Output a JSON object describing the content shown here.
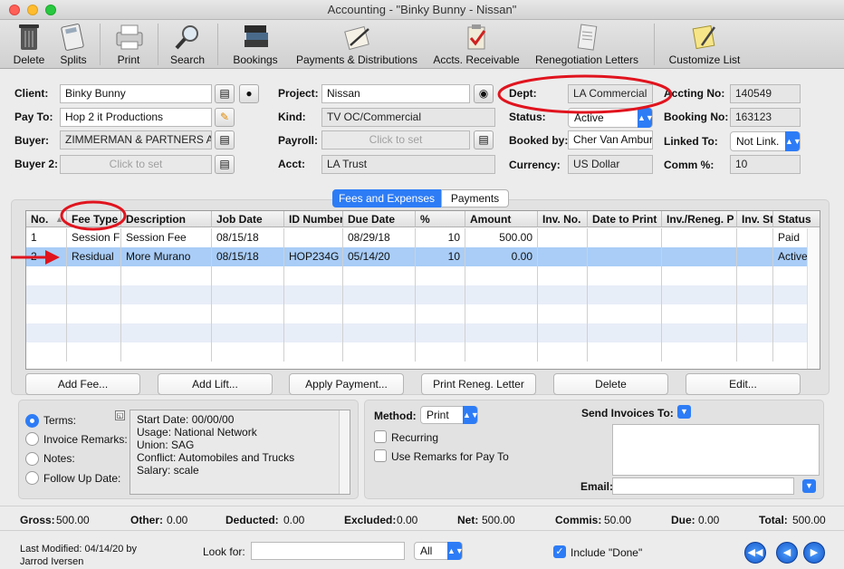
{
  "window": {
    "title": "Accounting - \"Binky Bunny - Nissan\""
  },
  "toolbar": {
    "delete": "Delete",
    "splits": "Splits",
    "print": "Print",
    "search": "Search",
    "bookings": "Bookings",
    "payments": "Payments & Distributions",
    "receivable": "Accts. Receivable",
    "renegotiation": "Renegotiation Letters",
    "customize": "Customize List"
  },
  "form": {
    "client_label": "Client:",
    "client": "Binky Bunny",
    "payto_label": "Pay To:",
    "payto": "Hop 2 it Productions",
    "buyer_label": "Buyer:",
    "buyer": "ZIMMERMAN & PARTNERS ADV",
    "buyer2_label": "Buyer 2:",
    "buyer2_placeholder": "Click to set",
    "project_label": "Project:",
    "project": "Nissan",
    "kind_label": "Kind:",
    "kind": "TV OC/Commercial",
    "payroll_label": "Payroll:",
    "payroll_placeholder": "Click to set",
    "acct_label": "Acct:",
    "acct": "LA Trust",
    "dept_label": "Dept:",
    "dept": "LA Commercial",
    "status_label": "Status:",
    "status": "Active",
    "bookedby_label": "Booked by:",
    "bookedby": "Cher Van Ambur",
    "currency_label": "Currency:",
    "currency": "US Dollar",
    "accting_label": "Accting No:",
    "accting": "140549",
    "booking_label": "Booking No:",
    "booking": "163123",
    "linked_label": "Linked To:",
    "linked": "Not Link.",
    "comm_label": "Comm %:",
    "comm": "10"
  },
  "tabs": {
    "fees": "Fees and Expenses",
    "payments": "Payments"
  },
  "table": {
    "headers": [
      "No.",
      "Fee Type",
      "Description",
      "Job Date",
      "ID Number",
      "Due Date",
      "%",
      "Amount",
      "Inv. No.",
      "Date to Print",
      "Inv./Reneg. P",
      "Inv. St",
      "Status"
    ],
    "rows": [
      [
        "1",
        "Session F",
        "Session Fee",
        "08/15/18",
        "",
        "08/29/18",
        "10",
        "500.00",
        "",
        "",
        "",
        "",
        "Paid"
      ],
      [
        "2",
        "Residual",
        "More Murano",
        "08/15/18",
        "HOP234G",
        "05/14/20",
        "10",
        "0.00",
        "",
        "",
        "",
        "",
        "Active"
      ]
    ]
  },
  "buttons": {
    "add_fee": "Add Fee...",
    "add_lift": "Add Lift...",
    "apply_payment": "Apply Payment...",
    "print_reneg": "Print Reneg. Letter",
    "delete": "Delete",
    "edit": "Edit..."
  },
  "notes": {
    "terms": "Terms:",
    "invoice_remarks": "Invoice Remarks:",
    "notes": "Notes:",
    "followup": "Follow Up Date:",
    "lines": [
      "Start Date: 00/00/00",
      "Usage: National Network",
      "Union: SAG",
      "Conflict: Automobiles and Trucks",
      "Salary: scale"
    ]
  },
  "invoice": {
    "method_label": "Method:",
    "method": "Print",
    "recurring": "Recurring",
    "use_remarks": "Use Remarks for Pay To",
    "send_label": "Send Invoices To:",
    "email_label": "Email:"
  },
  "summary": {
    "gross_l": "Gross:",
    "gross": "500.00",
    "other_l": "Other:",
    "other": "0.00",
    "deducted_l": "Deducted:",
    "deducted": "0.00",
    "excluded_l": "Excluded:",
    "excluded": "0.00",
    "net_l": "Net:",
    "net": "500.00",
    "commis_l": "Commis:",
    "commis": "50.00",
    "due_l": "Due:",
    "due": "0.00",
    "total_l": "Total:",
    "total": "500.00"
  },
  "footer": {
    "last_modified": "Last Modified: 04/14/20 by",
    "by_user": "Jarrod Iversen",
    "look_for": "Look for:",
    "filter": "All",
    "include_done": "Include \"Done\""
  },
  "colors": {
    "accent": "#2d7cf6",
    "annotation": "#e0141e",
    "selected_row": "#a9cdf7",
    "stripe": "#e8eef8"
  }
}
